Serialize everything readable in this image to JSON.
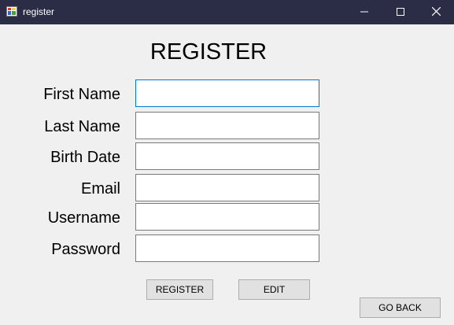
{
  "window": {
    "title": "register",
    "icon": "app-icon",
    "controls": {
      "minimize_icon": "minimize-icon",
      "maximize_icon": "maximize-icon",
      "close_icon": "close-icon"
    }
  },
  "form": {
    "heading": "REGISTER",
    "fields": [
      {
        "label": "First Name",
        "value": "",
        "focused": true
      },
      {
        "label": "Last Name",
        "value": ""
      },
      {
        "label": "Birth Date",
        "value": ""
      },
      {
        "label": "Email",
        "value": ""
      },
      {
        "label": "Username",
        "value": ""
      },
      {
        "label": "Password",
        "value": ""
      }
    ]
  },
  "buttons": {
    "register": "REGISTER",
    "edit": "EDIT",
    "go_back": "GO BACK"
  },
  "colors": {
    "titlebar": "#2b2d47",
    "window_bg": "#f0f0f0",
    "focus_border": "#0078d7",
    "button_bg": "#e1e1e1"
  }
}
